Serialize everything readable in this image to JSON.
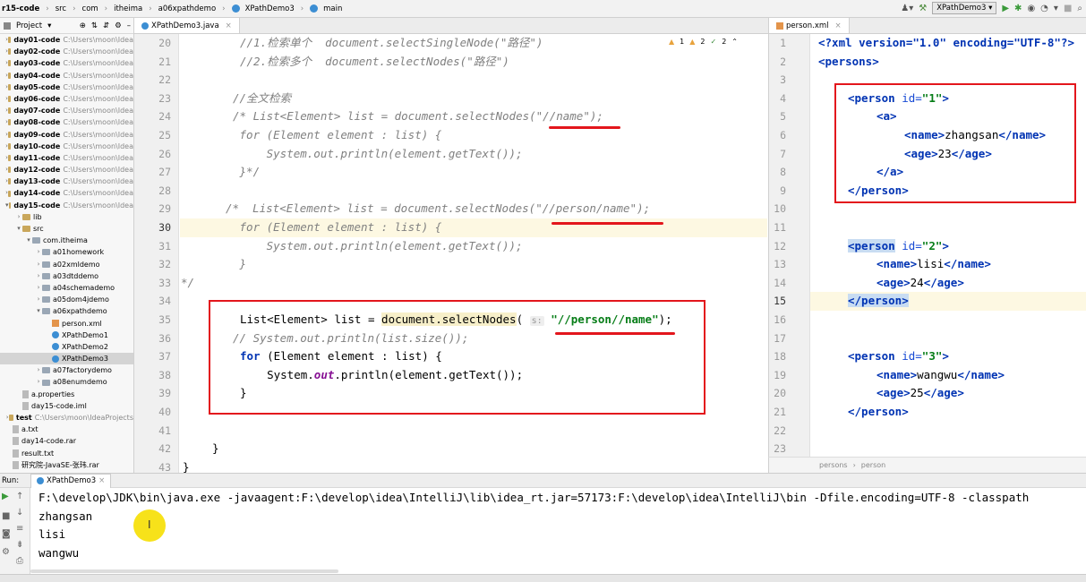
{
  "titlebar": {
    "crumbs": [
      "r15-code",
      "src",
      "com",
      "itheima",
      "a06xpathdemo",
      "XPathDemo3",
      "main"
    ],
    "run_config": "XPathDemo3"
  },
  "project_panel": {
    "title": "Project",
    "items": [
      {
        "name": "day01-code",
        "path": "C:\\Users\\moon\\Idea"
      },
      {
        "name": "day02-code",
        "path": "C:\\Users\\moon\\Idea"
      },
      {
        "name": "day03-code",
        "path": "C:\\Users\\moon\\Idea"
      },
      {
        "name": "day04-code",
        "path": "C:\\Users\\moon\\Idea"
      },
      {
        "name": "day05-code",
        "path": "C:\\Users\\moon\\Idea"
      },
      {
        "name": "day06-code",
        "path": "C:\\Users\\moon\\Idea"
      },
      {
        "name": "day07-code",
        "path": "C:\\Users\\moon\\Idea"
      },
      {
        "name": "day08-code",
        "path": "C:\\Users\\moon\\Idea"
      },
      {
        "name": "day09-code",
        "path": "C:\\Users\\moon\\Idea"
      },
      {
        "name": "day10-code",
        "path": "C:\\Users\\moon\\Idea"
      },
      {
        "name": "day11-code",
        "path": "C:\\Users\\moon\\Idea"
      },
      {
        "name": "day12-code",
        "path": "C:\\Users\\moon\\Idea"
      },
      {
        "name": "day13-code",
        "path": "C:\\Users\\moon\\Idea"
      },
      {
        "name": "day14-code",
        "path": "C:\\Users\\moon\\Idea"
      },
      {
        "name": "day15-code",
        "path": "C:\\Users\\moon\\Idea"
      },
      {
        "name": "lib",
        "path": ""
      },
      {
        "name": "src",
        "path": ""
      },
      {
        "name": "com.itheima",
        "path": ""
      },
      {
        "name": "a01homework",
        "path": ""
      },
      {
        "name": "a02xmldemo",
        "path": ""
      },
      {
        "name": "a03dtddemo",
        "path": ""
      },
      {
        "name": "a04schemademo",
        "path": ""
      },
      {
        "name": "a05dom4jdemo",
        "path": ""
      },
      {
        "name": "a06xpathdemo",
        "path": ""
      },
      {
        "name": "person.xml",
        "path": ""
      },
      {
        "name": "XPathDemo1",
        "path": ""
      },
      {
        "name": "XPathDemo2",
        "path": ""
      },
      {
        "name": "XPathDemo3",
        "path": ""
      },
      {
        "name": "a07factorydemo",
        "path": ""
      },
      {
        "name": "a08enumdemo",
        "path": ""
      },
      {
        "name": "a.properties",
        "path": ""
      },
      {
        "name": "day15-code.iml",
        "path": ""
      },
      {
        "name": "test",
        "path": "C:\\Users\\moon\\IdeaProjects"
      },
      {
        "name": "a.txt",
        "path": ""
      },
      {
        "name": "day14-code.rar",
        "path": ""
      },
      {
        "name": "result.txt",
        "path": ""
      },
      {
        "name": "研究院-JavaSE-张玮.rar",
        "path": ""
      }
    ]
  },
  "editor": {
    "tab": "XPathDemo3.java",
    "warnings": "1",
    "weak_warnings": "2",
    "typos": "2",
    "line_numbers": [
      "20",
      "21",
      "22",
      "23",
      "24",
      "25",
      "26",
      "27",
      "28",
      "29",
      "30",
      "31",
      "32",
      "33",
      "34",
      "35",
      "36",
      "37",
      "38",
      "39",
      "40",
      "41",
      "42",
      "43"
    ],
    "code": {
      "l20a": "//1.检索单个  ",
      "l20b": "document.selectSingleNode(\"路径\")",
      "l21a": "//2.检索多个  ",
      "l21b": "document.selectNodes(\"路径\")",
      "l23": "//全文检索",
      "l24a": "/* List<Element> list = document.selectNodes(",
      "l24s": "\"//name\"",
      "l24b": ");",
      "l25": " for (Element element : list) {",
      "l26": "     System.out.println(element.getText());",
      "l27": " }*/",
      "l29a": "/*  List<Element> list = document.selectNodes(",
      "l29s": "\"//person/name\"",
      "l29b": ");",
      "l30": " for (Element element : list) {",
      "l31": "     System.out.println(element.getText());",
      "l32": " }",
      "l33": "*/",
      "l35a": "List<Element> list = ",
      "l35m": "document.selectNodes",
      "l35p": "(",
      "l35h": "s:",
      "l35s": "\"//person//name\"",
      "l35b": ");",
      "l36": "// System.out.println(list.size());",
      "l37kw": "for",
      "l37a": " (Element element : list) {",
      "l38a": "    System.",
      "l38f": "out",
      "l38b": ".println(element.getText());",
      "l39": "}",
      "l42": "}",
      "l43": "}"
    }
  },
  "xml_editor": {
    "tab": "person.xml",
    "line_numbers": [
      "1",
      "2",
      "3",
      "4",
      "5",
      "6",
      "7",
      "8",
      "9",
      "10",
      "11",
      "12",
      "13",
      "14",
      "15",
      "16",
      "17",
      "18",
      "19",
      "20",
      "21",
      "22",
      "23"
    ],
    "lines": {
      "l1": "<?xml version=\"1.0\" encoding=\"UTF-8\"?>",
      "l2": "<persons>",
      "l4tag": "<person",
      "l4attr": " id=",
      "l4val": "\"1\"",
      "l4end": ">",
      "l5": "<a>",
      "l6a": "<name>",
      "l6t": "zhangsan",
      "l6b": "</name>",
      "l7a": "<age>",
      "l7t": "23",
      "l7b": "</age>",
      "l8": "</a>",
      "l9": "</person>",
      "l12tag": "<person",
      "l12attr": " id=",
      "l12val": "\"2\"",
      "l12end": ">",
      "l13a": "<name>",
      "l13t": "lisi",
      "l13b": "</name>",
      "l14a": "<age>",
      "l14t": "24",
      "l14b": "</age>",
      "l15": "</person>",
      "l18tag": "<person",
      "l18attr": " id=",
      "l18val": "\"3\"",
      "l18end": ">",
      "l19a": "<name>",
      "l19t": "wangwu",
      "l19b": "</name>",
      "l20a": "<age>",
      "l20t": "25",
      "l20b": "</age>",
      "l21": "</person>"
    },
    "breadcrumb": [
      "persons",
      "person"
    ]
  },
  "run_panel": {
    "label": "Run:",
    "tab": "XPathDemo3",
    "command": "F:\\develop\\JDK\\bin\\java.exe -javaagent:F:\\develop\\idea\\IntelliJ\\lib\\idea_rt.jar=57173:F:\\develop\\idea\\IntelliJ\\bin -Dfile.encoding=UTF-8 -classpath",
    "output": [
      "zhangsan",
      "lisi",
      "wangwu"
    ]
  }
}
